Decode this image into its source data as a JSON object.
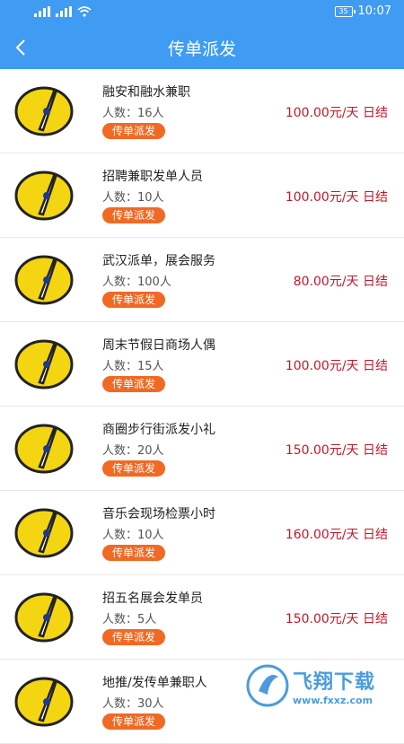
{
  "statusbar": {
    "time": "10:07",
    "battery": "35"
  },
  "header": {
    "title": "传单派发"
  },
  "jobs": [
    {
      "title": "融安和融水兼职",
      "people": "人数：16人",
      "tag": "传单派发",
      "salary": "100.00元/天  日结"
    },
    {
      "title": "招聘兼职发单人员",
      "people": "人数：10人",
      "tag": "传单派发",
      "salary": "100.00元/天  日结"
    },
    {
      "title": "武汉派单，展会服务",
      "people": "人数：100人",
      "tag": "传单派发",
      "salary": "80.00元/天  日结"
    },
    {
      "title": "周末节假日商场人偶",
      "people": "人数：15人",
      "tag": "传单派发",
      "salary": "100.00元/天  日结"
    },
    {
      "title": "商圈步行街派发小礼",
      "people": "人数：20人",
      "tag": "传单派发",
      "salary": "150.00元/天  日结"
    },
    {
      "title": "音乐会现场检票小时",
      "people": "人数：10人",
      "tag": "传单派发",
      "salary": "160.00元/天  日结"
    },
    {
      "title": "招五名展会发单员",
      "people": "人数：5人",
      "tag": "传单派发",
      "salary": "150.00元/天  日结"
    },
    {
      "title": "地推/发传单兼职人",
      "people": "人数：30人",
      "tag": "传单派发",
      "salary": ""
    }
  ],
  "watermark": {
    "brand": "飞翔下载",
    "url": "www.fxxz.com"
  }
}
